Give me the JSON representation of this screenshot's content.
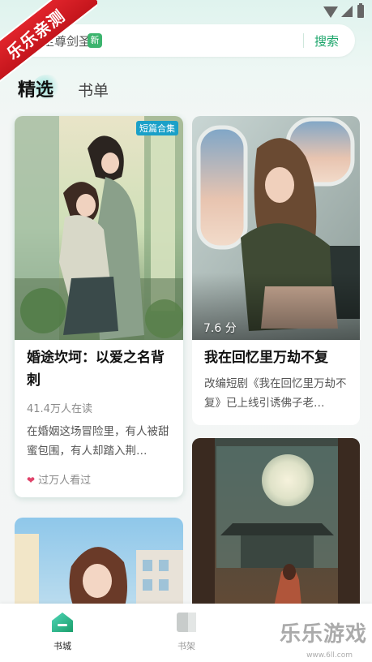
{
  "watermark": {
    "ribbon_text": "乐乐亲测",
    "brand_text": "乐乐游戏",
    "brand_url": "www.6ll.com"
  },
  "search": {
    "hint_text": "至尊剑圣",
    "new_badge": "新",
    "button_label": "搜索"
  },
  "tabs": [
    {
      "label": "精选",
      "selected": true
    },
    {
      "label": "书单",
      "selected": false
    }
  ],
  "books": [
    {
      "title": "婚途坎坷：以爱之名背刺",
      "tag": "短篇合集",
      "readers": "41.4万人在读",
      "desc": "在婚姻这场冒险里，有人被甜蜜包围，有人却踏入荆…",
      "heat": "过万人看过"
    },
    {
      "title": "我在回忆里万劫不复",
      "score": "7.6 分",
      "desc": "改编短剧《我在回忆里万劫不复》已上线引诱佛子老…"
    }
  ],
  "nav": [
    {
      "label": "书城",
      "active": true,
      "icon": "home-icon"
    },
    {
      "label": "书架",
      "active": false,
      "icon": "bookshelf-icon"
    }
  ],
  "colors": {
    "accent": "#1ba56a",
    "badge_green": "#3cb46e",
    "tag_blue": "#1aa0c8",
    "ribbon_red": "#d81e25"
  }
}
